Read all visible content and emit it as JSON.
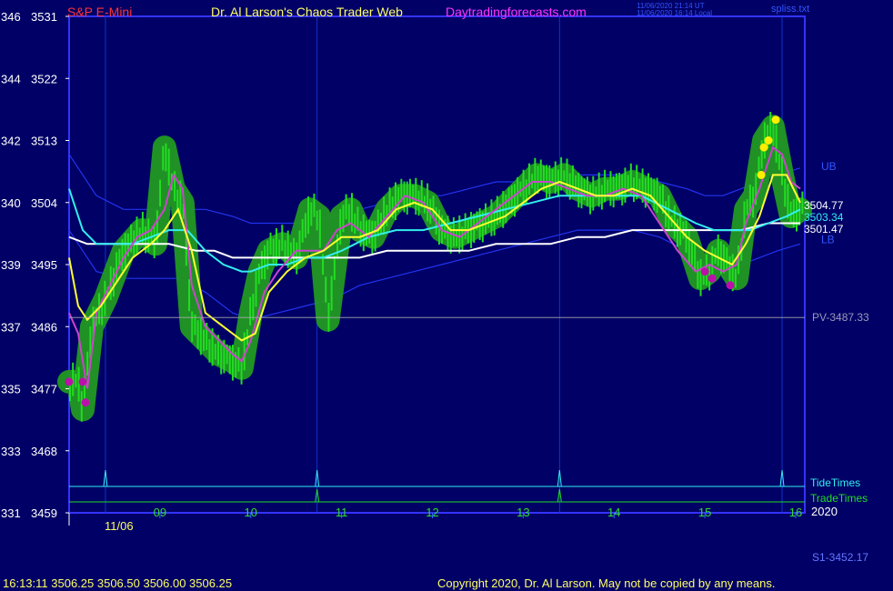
{
  "header": {
    "symbol": "S&P E-Mini",
    "site_title": "Dr. Al Larson's Chaos Trader Web",
    "link": "Daytradingforecasts.com",
    "timestamp_ut": "11/06/2020 21:14 UT",
    "timestamp_local": "11/06/2020 16:14 Local",
    "file_name": "spliss.txt"
  },
  "footer": {
    "quote": "16:13:11  3506.25 3506.50 3506.00 3506.25",
    "copyright": "Copyright 2020, Dr. Al Larson. May not be copied by any means.",
    "s1_label": "S1-3452.17",
    "date_label": "11/06",
    "year_label": "2020"
  },
  "colors": {
    "background": "#000066",
    "price_bars": "#22dd22",
    "glow": "#229922",
    "magenta_line": "#cc44cc",
    "yellow_line": "#ffff33",
    "cyan_line": "#33eeee",
    "white_line": "#ffffff",
    "bands": "#2233ee",
    "frame": "#3333ff"
  },
  "chart_data": {
    "type": "line",
    "title": "S&P E-Mini",
    "y_left_ticks": [
      "346",
      "344",
      "342",
      "340",
      "339",
      "337",
      "335",
      "333",
      "331"
    ],
    "y_right_ticks": [
      "3531",
      "3522",
      "3513",
      "3504",
      "3495",
      "3486",
      "3477",
      "3468",
      "3459"
    ],
    "ylim": [
      3459,
      3531
    ],
    "x_ticks": [
      "09",
      "10",
      "11",
      "12",
      "13",
      "14",
      "15",
      "16"
    ],
    "xlim": [
      8.0,
      16.1
    ],
    "pivot": {
      "label": "PV-3487.33",
      "value": 3487.33
    },
    "band_labels": {
      "upper": "UB",
      "lower": "LB"
    },
    "end_labels": [
      {
        "text": "3504.77",
        "value": 3504.77,
        "color": "#ffffff"
      },
      {
        "text": "3503.34",
        "value": 3503.34,
        "color": "#33eeee"
      },
      {
        "text": "3501.47",
        "value": 3501.47,
        "color": "#ffffff"
      }
    ],
    "tide_times": {
      "label": "TideTimes",
      "times": [
        8.4,
        10.73,
        13.4,
        15.85
      ]
    },
    "trade_times": {
      "label": "TradeTimes",
      "times": [
        10.73,
        13.4
      ]
    },
    "series": [
      {
        "name": "price",
        "color": "#22dd22",
        "x": [
          8.0,
          8.1,
          8.15,
          8.25,
          8.4,
          8.6,
          8.8,
          8.95,
          9.05,
          9.15,
          9.25,
          9.35,
          9.5,
          9.65,
          9.8,
          9.9,
          10.0,
          10.1,
          10.2,
          10.35,
          10.5,
          10.65,
          10.75,
          10.85,
          11.0,
          11.1,
          11.2,
          11.35,
          11.5,
          11.65,
          11.8,
          11.95,
          12.1,
          12.25,
          12.4,
          12.55,
          12.7,
          12.85,
          13.0,
          13.15,
          13.3,
          13.45,
          13.6,
          13.75,
          13.9,
          14.05,
          14.2,
          14.35,
          14.5,
          14.65,
          14.8,
          14.95,
          15.05,
          15.15,
          15.25,
          15.35,
          15.45,
          15.55,
          15.65,
          15.75,
          15.85,
          15.95,
          16.05
        ],
        "y": [
          3478,
          3478,
          3474,
          3486,
          3490,
          3497,
          3500,
          3498,
          3512,
          3506,
          3504,
          3486,
          3484,
          3482,
          3481,
          3480,
          3488,
          3494,
          3497,
          3498,
          3496,
          3503,
          3502,
          3487,
          3502,
          3503,
          3500,
          3499,
          3503,
          3505,
          3505,
          3504,
          3500,
          3499,
          3500,
          3501,
          3502,
          3504,
          3506,
          3508,
          3507,
          3508,
          3506,
          3505,
          3506,
          3506,
          3507,
          3506,
          3505,
          3501,
          3499,
          3493,
          3494,
          3497,
          3495,
          3493,
          3503,
          3505,
          3513,
          3515,
          3508,
          3502,
          3503
        ]
      },
      {
        "name": "magenta",
        "color": "#cc44cc",
        "x": [
          8.0,
          8.1,
          8.2,
          8.3,
          8.45,
          8.6,
          8.75,
          8.9,
          9.05,
          9.15,
          9.25,
          9.35,
          9.5,
          9.65,
          9.8,
          9.9,
          10.0,
          10.15,
          10.3,
          10.5,
          10.65,
          10.8,
          10.95,
          11.1,
          11.3,
          11.5,
          11.7,
          11.9,
          12.1,
          12.3,
          12.5,
          12.7,
          12.9,
          13.1,
          13.3,
          13.5,
          13.7,
          13.9,
          14.1,
          14.3,
          14.5,
          14.7,
          14.9,
          15.05,
          15.2,
          15.35,
          15.45,
          15.6,
          15.75,
          15.85,
          15.95,
          16.05
        ],
        "y": [
          3488,
          3485,
          3477,
          3488,
          3492,
          3496,
          3499,
          3500,
          3503,
          3508,
          3506,
          3492,
          3486,
          3484,
          3482,
          3481,
          3484,
          3491,
          3494,
          3497,
          3497,
          3497,
          3500,
          3501,
          3499,
          3502,
          3505,
          3504,
          3500,
          3499,
          3501,
          3503,
          3505,
          3507,
          3507,
          3506,
          3505,
          3505,
          3506,
          3505,
          3501,
          3497,
          3494,
          3495,
          3494,
          3495,
          3501,
          3506,
          3512,
          3511,
          3507,
          3506
        ]
      },
      {
        "name": "yellow",
        "color": "#ffff33",
        "x": [
          8.0,
          8.1,
          8.2,
          8.35,
          8.5,
          8.7,
          8.9,
          9.05,
          9.2,
          9.35,
          9.5,
          9.7,
          9.9,
          10.05,
          10.2,
          10.4,
          10.6,
          10.8,
          11.0,
          11.2,
          11.4,
          11.6,
          11.8,
          12.0,
          12.2,
          12.4,
          12.6,
          12.8,
          13.0,
          13.2,
          13.4,
          13.6,
          13.8,
          14.0,
          14.2,
          14.4,
          14.6,
          14.8,
          15.0,
          15.15,
          15.3,
          15.45,
          15.6,
          15.75,
          15.9,
          16.05
        ],
        "y": [
          3496,
          3489,
          3487,
          3489,
          3492,
          3496,
          3498,
          3500,
          3503,
          3497,
          3488,
          3486,
          3484,
          3485,
          3491,
          3494,
          3496,
          3497,
          3499,
          3499,
          3500,
          3503,
          3504,
          3503,
          3500,
          3500,
          3501,
          3502,
          3504,
          3506,
          3507,
          3506,
          3505,
          3505,
          3506,
          3505,
          3502,
          3499,
          3497,
          3496,
          3495,
          3498,
          3502,
          3508,
          3508,
          3504
        ]
      },
      {
        "name": "cyan",
        "color": "#33eeee",
        "x": [
          8.0,
          8.15,
          8.3,
          8.5,
          8.7,
          8.9,
          9.1,
          9.3,
          9.5,
          9.7,
          9.9,
          10.0,
          10.2,
          10.4,
          10.6,
          10.8,
          11.0,
          11.3,
          11.6,
          11.9,
          12.2,
          12.5,
          12.8,
          13.1,
          13.4,
          13.7,
          14.0,
          14.3,
          14.6,
          14.9,
          15.1,
          15.3,
          15.5,
          15.7,
          15.9,
          16.05
        ],
        "y": [
          3506,
          3500,
          3498,
          3498,
          3498,
          3499,
          3500,
          3500,
          3497,
          3495,
          3494,
          3494,
          3495,
          3495,
          3496,
          3496,
          3497,
          3499,
          3500,
          3500,
          3501,
          3502,
          3503,
          3504,
          3505,
          3505,
          3505,
          3505,
          3503,
          3501,
          3500,
          3500,
          3500,
          3501,
          3502,
          3503
        ]
      },
      {
        "name": "white",
        "color": "#ffffff",
        "x": [
          8.0,
          8.2,
          8.5,
          8.8,
          9.1,
          9.4,
          9.6,
          9.8,
          10.0,
          10.3,
          10.6,
          10.9,
          11.2,
          11.5,
          11.8,
          12.1,
          12.4,
          12.7,
          13.0,
          13.3,
          13.6,
          13.9,
          14.2,
          14.5,
          14.8,
          15.1,
          15.4,
          15.7,
          16.05
        ],
        "y": [
          3499,
          3498,
          3498,
          3498,
          3498,
          3497,
          3497,
          3496,
          3496,
          3496,
          3496,
          3496,
          3496,
          3497,
          3497,
          3497,
          3497,
          3498,
          3498,
          3498,
          3499,
          3499,
          3500,
          3500,
          3500,
          3500,
          3500,
          3501,
          3501
        ]
      },
      {
        "name": "upper band",
        "color": "#2233ee",
        "x": [
          8.0,
          8.3,
          8.6,
          8.9,
          9.2,
          9.5,
          9.8,
          10.0,
          10.3,
          10.6,
          10.9,
          11.2,
          11.5,
          11.8,
          12.1,
          12.4,
          12.7,
          13.0,
          13.3,
          13.6,
          13.9,
          14.2,
          14.5,
          14.8,
          15.0,
          15.2,
          15.4,
          15.6,
          15.8,
          16.05
        ],
        "y": [
          3511,
          3505,
          3503,
          3503,
          3503,
          3503,
          3502,
          3501,
          3501,
          3501,
          3502,
          3503,
          3504,
          3505,
          3505,
          3506,
          3507,
          3507,
          3508,
          3508,
          3508,
          3508,
          3507,
          3506,
          3505,
          3505,
          3506,
          3507,
          3508,
          3509
        ]
      },
      {
        "name": "lower band",
        "color": "#2233ee",
        "x": [
          8.0,
          8.3,
          8.6,
          8.9,
          9.2,
          9.5,
          9.8,
          10.0,
          10.3,
          10.6,
          10.9,
          11.2,
          11.5,
          11.8,
          12.1,
          12.4,
          12.7,
          13.0,
          13.3,
          13.6,
          13.9,
          14.2,
          14.5,
          14.8,
          15.0,
          15.2,
          15.4,
          15.6,
          15.8,
          16.05
        ],
        "y": [
          3500,
          3494,
          3493,
          3493,
          3493,
          3491,
          3488,
          3487,
          3488,
          3489,
          3490,
          3492,
          3493,
          3494,
          3495,
          3496,
          3497,
          3498,
          3499,
          3500,
          3500,
          3500,
          3499,
          3497,
          3495,
          3494,
          3495,
          3496,
          3497,
          3498
        ]
      }
    ],
    "highlights": [
      {
        "color": "#bb11aa",
        "x": [
          8.0,
          8.15,
          8.18,
          15.0,
          15.08,
          15.28
        ],
        "y": [
          3478,
          3478,
          3475,
          3494,
          3493,
          3492
        ]
      },
      {
        "color": "#ffee00",
        "x": [
          15.62,
          15.65,
          15.7,
          15.78
        ],
        "y": [
          3508,
          3512,
          3513,
          3516
        ]
      }
    ]
  }
}
